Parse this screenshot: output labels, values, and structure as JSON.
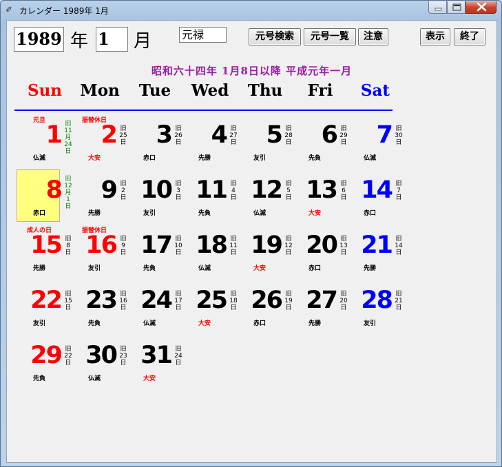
{
  "window": {
    "title": "カレンダー 1989年  1月",
    "title_icon": "feather-icon"
  },
  "controls": {
    "year_value": "1989",
    "year_label": "年",
    "month_value": "1",
    "month_label": "月",
    "era_value": "元禄",
    "buttons": {
      "era_search": "元号検索",
      "era_list": "元号一覧",
      "notice": "注意",
      "show": "表示",
      "quit": "終了"
    }
  },
  "notice": "昭和六十四年 1月8日以降 平成元年一月",
  "weekdays": [
    {
      "label": "Sun",
      "color": "#ff0000"
    },
    {
      "label": "Mon",
      "color": "#000000"
    },
    {
      "label": "Tue",
      "color": "#000000"
    },
    {
      "label": "Wed",
      "color": "#000000"
    },
    {
      "label": "Thu",
      "color": "#000000"
    },
    {
      "label": "Fri",
      "color": "#000000"
    },
    {
      "label": "Sat",
      "color": "#0000ff"
    }
  ],
  "days": [
    {
      "day": "1",
      "holiday": "元旦",
      "old": [
        "旧",
        "11",
        "月",
        "24",
        "日"
      ],
      "rokuyo": "仏滅",
      "color": "red",
      "old_color": "green",
      "rokuyo_red": false
    },
    {
      "day": "2",
      "holiday": "振替休日",
      "old": [
        "旧",
        "25",
        "日"
      ],
      "rokuyo": "大安",
      "color": "red",
      "rokuyo_red": true
    },
    {
      "day": "3",
      "old": [
        "旧",
        "26",
        "日"
      ],
      "rokuyo": "赤口",
      "color": "black"
    },
    {
      "day": "4",
      "old": [
        "旧",
        "27",
        "日"
      ],
      "rokuyo": "先勝",
      "color": "black"
    },
    {
      "day": "5",
      "old": [
        "旧",
        "28",
        "日"
      ],
      "rokuyo": "友引",
      "color": "black"
    },
    {
      "day": "6",
      "old": [
        "旧",
        "29",
        "日"
      ],
      "rokuyo": "先負",
      "color": "black"
    },
    {
      "day": "7",
      "old": [
        "旧",
        "30",
        "日"
      ],
      "rokuyo": "仏滅",
      "color": "blue"
    },
    {
      "day": "8",
      "old": [
        "旧",
        "12",
        "月",
        "1",
        "日"
      ],
      "rokuyo": "赤口",
      "color": "red",
      "old_color": "green",
      "highlight": true
    },
    {
      "day": "9",
      "old": [
        "旧",
        "2",
        "日"
      ],
      "rokuyo": "先勝",
      "color": "black"
    },
    {
      "day": "10",
      "old": [
        "旧",
        "3",
        "日"
      ],
      "rokuyo": "友引",
      "color": "black"
    },
    {
      "day": "11",
      "old": [
        "旧",
        "4",
        "日"
      ],
      "rokuyo": "先負",
      "color": "black"
    },
    {
      "day": "12",
      "old": [
        "旧",
        "5",
        "日"
      ],
      "rokuyo": "仏滅",
      "color": "black"
    },
    {
      "day": "13",
      "old": [
        "旧",
        "6",
        "日"
      ],
      "rokuyo": "大安",
      "color": "black",
      "rokuyo_red": true
    },
    {
      "day": "14",
      "old": [
        "旧",
        "7",
        "日"
      ],
      "rokuyo": "赤口",
      "color": "blue"
    },
    {
      "day": "15",
      "holiday": "成人の日",
      "old": [
        "旧",
        "8",
        "日"
      ],
      "rokuyo": "先勝",
      "color": "red"
    },
    {
      "day": "16",
      "holiday": "振替休日",
      "old": [
        "旧",
        "9",
        "日"
      ],
      "rokuyo": "友引",
      "color": "red"
    },
    {
      "day": "17",
      "old": [
        "旧",
        "10",
        "日"
      ],
      "rokuyo": "先負",
      "color": "black"
    },
    {
      "day": "18",
      "old": [
        "旧",
        "11",
        "日"
      ],
      "rokuyo": "仏滅",
      "color": "black"
    },
    {
      "day": "19",
      "old": [
        "旧",
        "12",
        "日"
      ],
      "rokuyo": "大安",
      "color": "black",
      "rokuyo_red": true
    },
    {
      "day": "20",
      "old": [
        "旧",
        "13",
        "日"
      ],
      "rokuyo": "赤口",
      "color": "black"
    },
    {
      "day": "21",
      "old": [
        "旧",
        "14",
        "日"
      ],
      "rokuyo": "先勝",
      "color": "blue"
    },
    {
      "day": "22",
      "old": [
        "旧",
        "15",
        "日"
      ],
      "rokuyo": "友引",
      "color": "red"
    },
    {
      "day": "23",
      "old": [
        "旧",
        "16",
        "日"
      ],
      "rokuyo": "先負",
      "color": "black"
    },
    {
      "day": "24",
      "old": [
        "旧",
        "17",
        "日"
      ],
      "rokuyo": "仏滅",
      "color": "black"
    },
    {
      "day": "25",
      "old": [
        "旧",
        "18",
        "日"
      ],
      "rokuyo": "大安",
      "color": "black",
      "rokuyo_red": true
    },
    {
      "day": "26",
      "old": [
        "旧",
        "19",
        "日"
      ],
      "rokuyo": "赤口",
      "color": "black"
    },
    {
      "day": "27",
      "old": [
        "旧",
        "20",
        "日"
      ],
      "rokuyo": "先勝",
      "color": "black"
    },
    {
      "day": "28",
      "old": [
        "旧",
        "21",
        "日"
      ],
      "rokuyo": "友引",
      "color": "blue"
    },
    {
      "day": "29",
      "old": [
        "旧",
        "22",
        "日"
      ],
      "rokuyo": "先負",
      "color": "red"
    },
    {
      "day": "30",
      "old": [
        "旧",
        "23",
        "日"
      ],
      "rokuyo": "仏滅",
      "color": "black"
    },
    {
      "day": "31",
      "old": [
        "旧",
        "24",
        "日"
      ],
      "rokuyo": "大安",
      "color": "black",
      "rokuyo_red": true
    }
  ]
}
